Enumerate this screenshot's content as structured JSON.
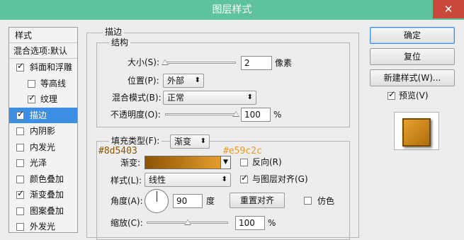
{
  "window": {
    "title": "图层样式",
    "close_glyph": "✕"
  },
  "sidebar": {
    "header": "样式",
    "blend": "混合选项:默认",
    "items": [
      {
        "label": "斜面和浮雕",
        "checked": true,
        "indent": false,
        "selected": false
      },
      {
        "label": "等高线",
        "checked": false,
        "indent": true,
        "selected": false
      },
      {
        "label": "纹理",
        "checked": true,
        "indent": true,
        "selected": false
      },
      {
        "label": "描边",
        "checked": true,
        "indent": false,
        "selected": true
      },
      {
        "label": "内阴影",
        "checked": false,
        "indent": false,
        "selected": false
      },
      {
        "label": "内发光",
        "checked": false,
        "indent": false,
        "selected": false
      },
      {
        "label": "光泽",
        "checked": false,
        "indent": false,
        "selected": false
      },
      {
        "label": "颜色叠加",
        "checked": false,
        "indent": false,
        "selected": false
      },
      {
        "label": "渐变叠加",
        "checked": true,
        "indent": false,
        "selected": false
      },
      {
        "label": "图案叠加",
        "checked": false,
        "indent": false,
        "selected": false
      },
      {
        "label": "外发光",
        "checked": false,
        "indent": false,
        "selected": false
      }
    ]
  },
  "stroke": {
    "section_title": "描边",
    "structure_title": "结构",
    "size_label": "大小(S):",
    "size_value": "2",
    "size_unit": "像素",
    "size_slider": 0.0,
    "position_label": "位置(P):",
    "position_value": "外部",
    "blend_label": "混合模式(B):",
    "blend_value": "正常",
    "opacity_label": "不透明度(O):",
    "opacity_value": "100",
    "opacity_unit": "%",
    "opacity_slider": 1.0,
    "fill_type_label": "填充类型(F):",
    "fill_type_value": "渐变",
    "gradient_label": "渐变:",
    "gradient_start_color": "#8d5403",
    "gradient_end_color": "#e59c2c",
    "gradient_start_label": "#8d5403",
    "gradient_end_label": "#e59c2c",
    "reverse_label": "反向(R)",
    "reverse_checked": false,
    "style_label": "样式(L):",
    "style_value": "线性",
    "align_label": "与图层对齐(G)",
    "align_checked": true,
    "angle_label": "角度(A):",
    "angle_value": "90",
    "angle_unit": "度",
    "reset_align_label": "重置对齐",
    "dither_label": "仿色",
    "dither_checked": false,
    "scale_label": "缩放(C):",
    "scale_value": "100",
    "scale_unit": "%",
    "scale_slider": 0.5
  },
  "buttons": {
    "ok": "确定",
    "reset": "复位",
    "new_style": "新建样式(W)...",
    "preview_label": "预览(V)",
    "preview_checked": true
  },
  "colors": {
    "titlebar": "#5ec29d",
    "selection": "#3c8fe2",
    "close": "#c9483b"
  }
}
